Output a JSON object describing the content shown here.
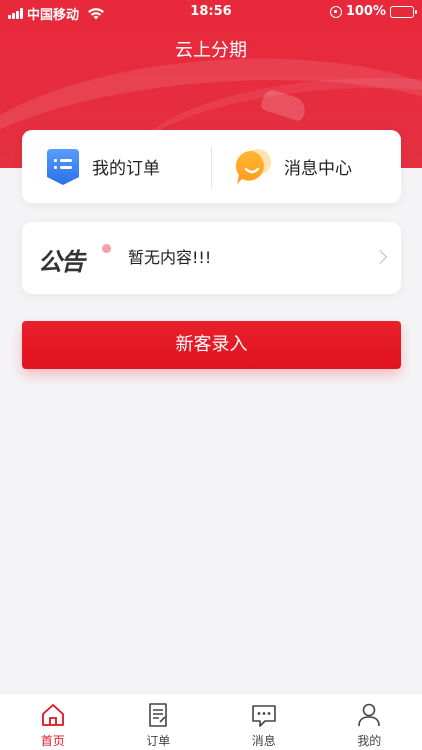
{
  "statusbar": {
    "carrier": "中国移动",
    "time": "18:56",
    "battery": "100%"
  },
  "header": {
    "title": "云上分期"
  },
  "shortcuts": [
    {
      "label": "我的订单",
      "icon": "order-list-icon"
    },
    {
      "label": "消息中心",
      "icon": "message-bubble-icon"
    }
  ],
  "notice": {
    "logo_text_1": "公",
    "logo_text_2": "告",
    "content": "暂无内容!!!"
  },
  "actions": {
    "new_client_label": "新客录入"
  },
  "tabbar": {
    "tabs": [
      {
        "label": "首页",
        "icon": "home-icon",
        "active": true
      },
      {
        "label": "订单",
        "icon": "order-icon",
        "active": false
      },
      {
        "label": "消息",
        "icon": "message-icon",
        "active": false
      },
      {
        "label": "我的",
        "icon": "user-icon",
        "active": false
      }
    ]
  },
  "colors": {
    "brand": "#e0131f",
    "header": "#e8283b",
    "background": "#f4f4f6"
  }
}
